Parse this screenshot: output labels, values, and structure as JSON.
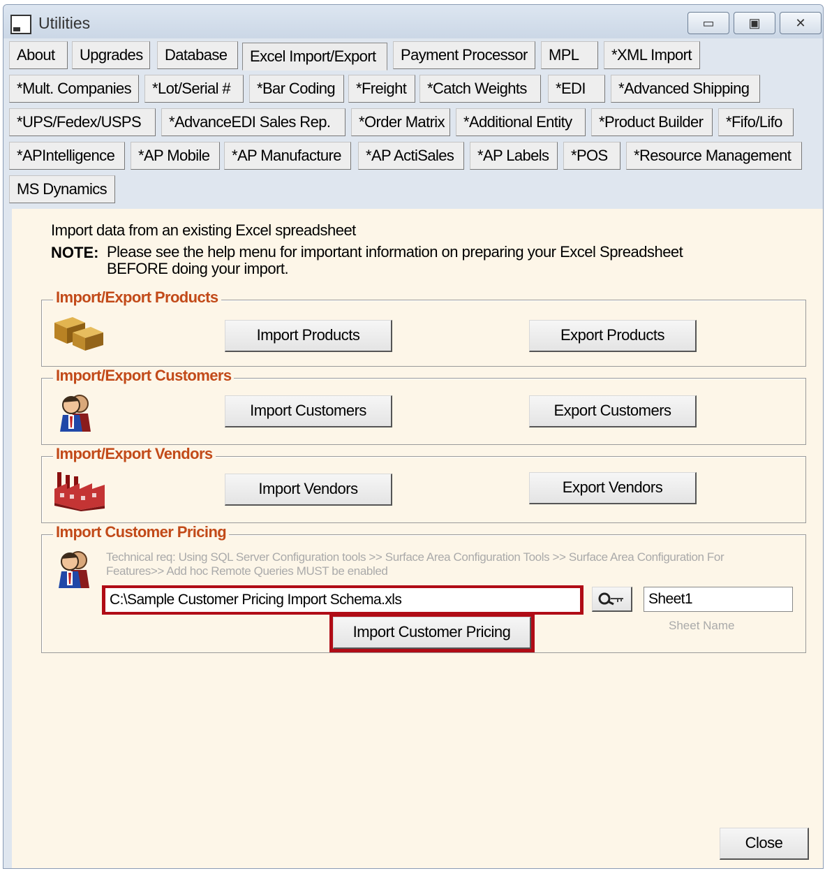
{
  "window": {
    "title": "Utilities",
    "minimize_glyph": "▭",
    "maximize_glyph": "▣",
    "close_glyph": "✕"
  },
  "tabs": [
    {
      "label": "About",
      "active": false
    },
    {
      "label": "Upgrades",
      "active": false
    },
    {
      "label": "Database",
      "active": false
    },
    {
      "label": "Excel Import/Export",
      "active": true
    },
    {
      "label": "Payment Processor",
      "active": false
    },
    {
      "label": "MPL",
      "active": false
    },
    {
      "label": "*XML Import",
      "active": false
    },
    {
      "label": "*Mult. Companies",
      "active": false
    },
    {
      "label": "*Lot/Serial #",
      "active": false
    },
    {
      "label": "*Bar Coding",
      "active": false
    },
    {
      "label": "*Freight",
      "active": false
    },
    {
      "label": "*Catch Weights",
      "active": false
    },
    {
      "label": "*EDI",
      "active": false
    },
    {
      "label": "*Advanced Shipping",
      "active": false
    },
    {
      "label": "*UPS/Fedex/USPS",
      "active": false
    },
    {
      "label": "*AdvanceEDI Sales Rep.",
      "active": false
    },
    {
      "label": "*Order Matrix",
      "active": false
    },
    {
      "label": "*Additional Entity",
      "active": false
    },
    {
      "label": "*Product Builder",
      "active": false
    },
    {
      "label": "*Fifo/Lifo",
      "active": false
    },
    {
      "label": "*APIntelligence",
      "active": false
    },
    {
      "label": "*AP Mobile",
      "active": false
    },
    {
      "label": "*AP Manufacture",
      "active": false
    },
    {
      "label": "*AP ActiSales",
      "active": false
    },
    {
      "label": "*AP Labels",
      "active": false
    },
    {
      "label": "*POS",
      "active": false
    },
    {
      "label": "*Resource Management",
      "active": false
    },
    {
      "label": "MS Dynamics",
      "active": false
    }
  ],
  "content": {
    "intro": "Import data from an existing Excel spreadsheet",
    "note_label": "NOTE:",
    "note_text": "Please see the help menu for important information on preparing your Excel Spreadsheet BEFORE doing your import."
  },
  "products": {
    "legend": "Import/Export Products",
    "import_label": "Import Products",
    "export_label": "Export Products"
  },
  "customers": {
    "legend": "Import/Export Customers",
    "import_label": "Import Customers",
    "export_label": "Export Customers"
  },
  "vendors": {
    "legend": "Import/Export Vendors",
    "import_label": "Import Vendors",
    "export_label": "Export Vendors"
  },
  "pricing": {
    "legend": "Import Customer Pricing",
    "tech_req": "Technical req: Using SQL Server Configuration tools >> Surface Area Configuration Tools  >> Surface Area Configuration For Features>> Add hoc Remote Queries MUST be enabled",
    "file_path": "C:\\Sample Customer Pricing Import Schema.xls",
    "sheet_name": "Sheet1",
    "sheet_caption": "Sheet Name",
    "import_label": "Import Customer Pricing",
    "highlight_color": "#b00c16"
  },
  "footer": {
    "close_label": "Close"
  }
}
